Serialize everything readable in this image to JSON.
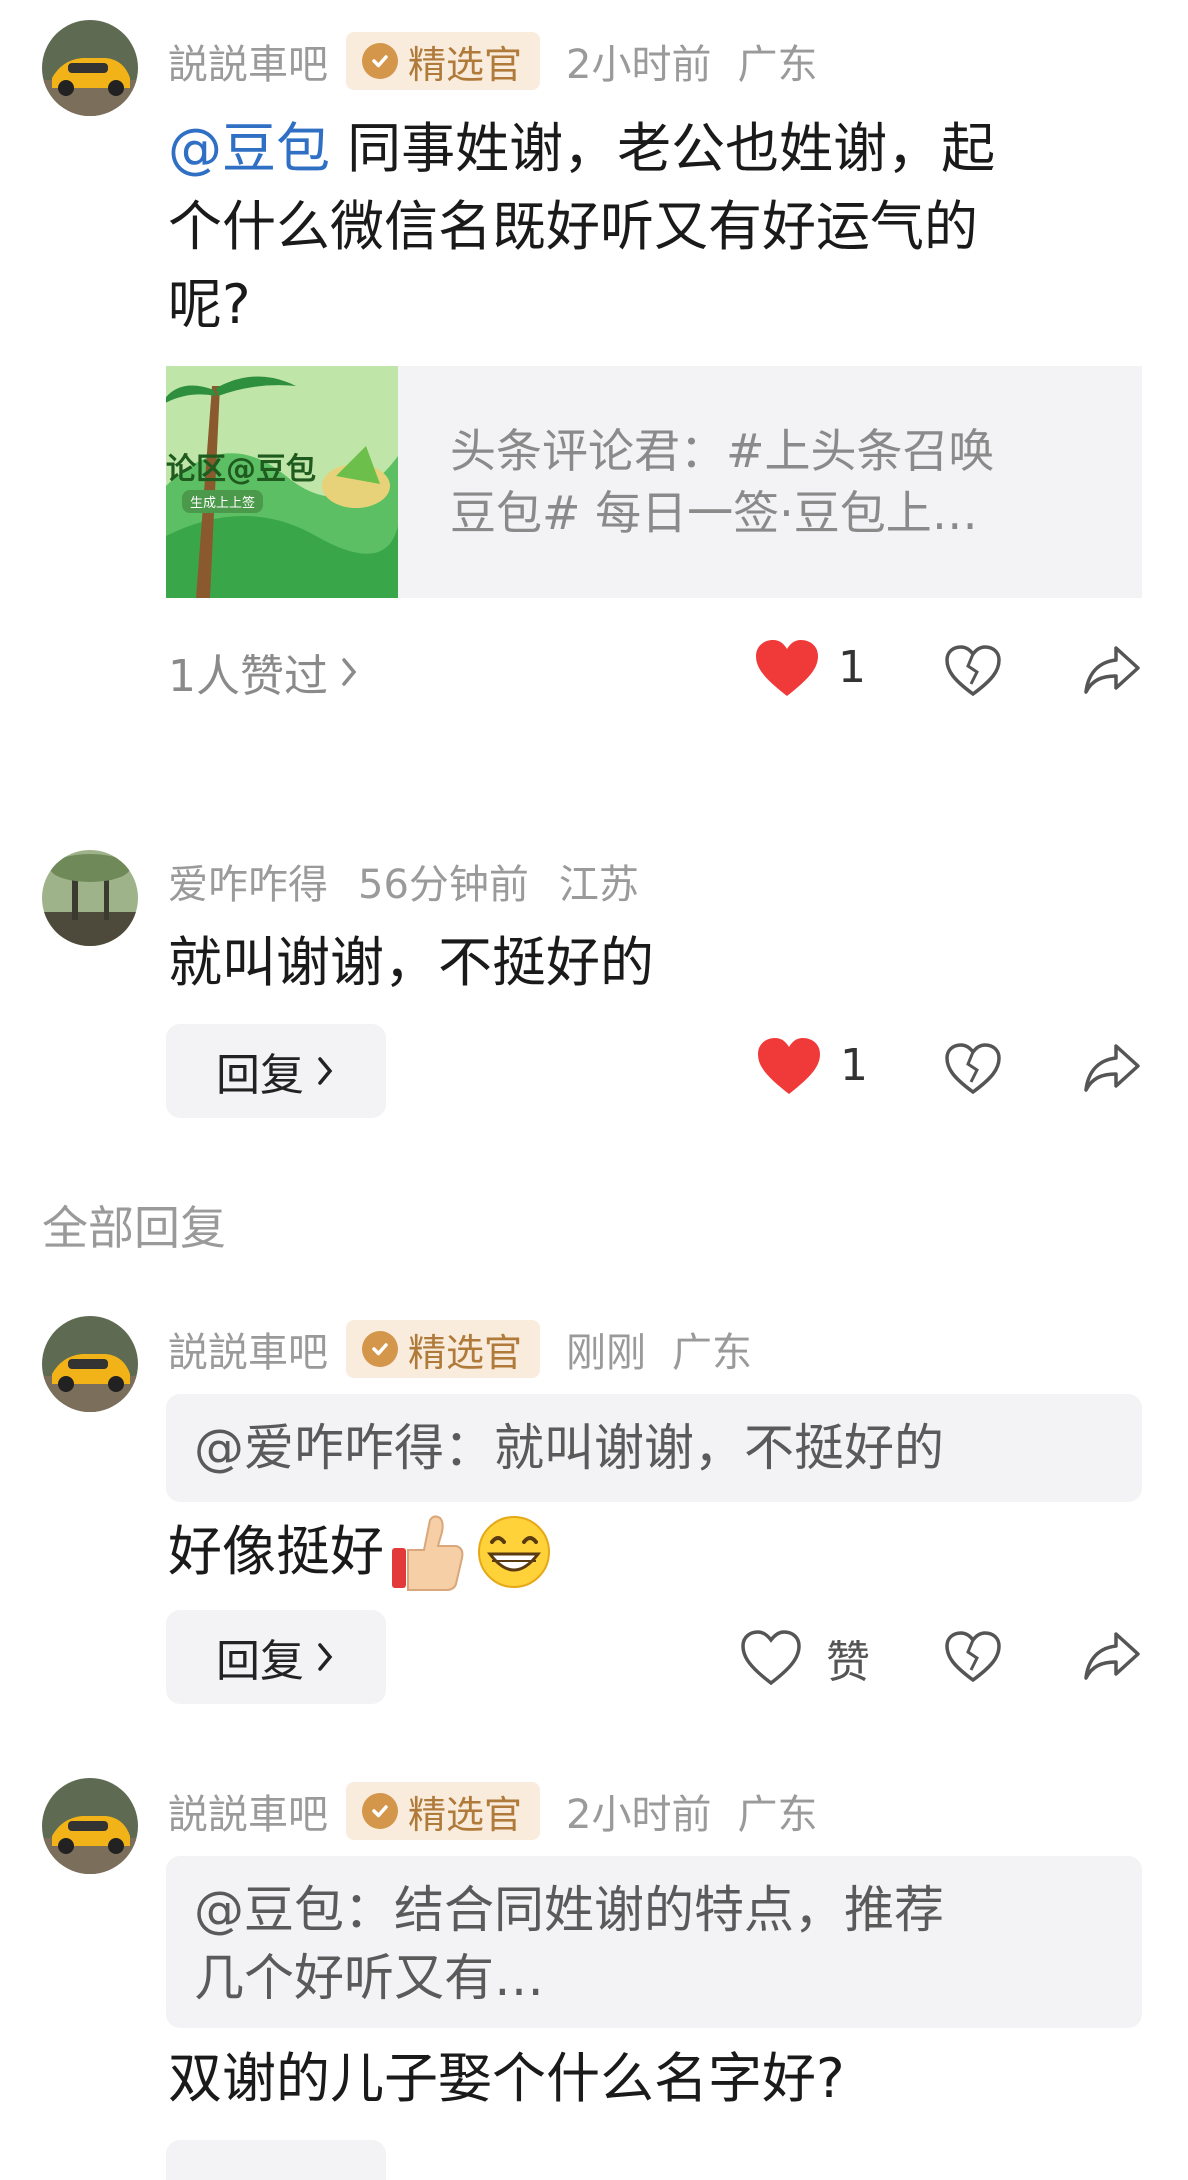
{
  "post": {
    "author": "説説車吧",
    "badge": "精选官",
    "time": "2小时前",
    "location": "广东",
    "mention": "@豆包",
    "line1": " 同事姓谢，老公也姓谢，起",
    "line2": "个什么微信名既好听又有好运气的",
    "line3": "呢?",
    "card": {
      "thumb_text": "论区@豆包",
      "thumb_sub": "生成上上签",
      "line1": "头条评论君：#上头条召唤",
      "line2": "豆包# 每日一签·豆包上…"
    },
    "likes_summary": "1人赞过",
    "like_count": "1"
  },
  "comment1": {
    "author": "爱咋咋得",
    "time": "56分钟前",
    "location": "江苏",
    "text": "就叫谢谢，不挺好的",
    "reply_label": "回复",
    "like_count": "1"
  },
  "section": {
    "title": "全部回复"
  },
  "reply1": {
    "author": "説説車吧",
    "badge": "精选官",
    "time": "刚刚",
    "location": "广东",
    "quote": "@爱咋咋得：就叫谢谢，不挺好的",
    "text": "好像挺好",
    "reply_label": "回复",
    "like_label": "赞"
  },
  "reply2": {
    "author": "説説車吧",
    "badge": "精选官",
    "time": "2小时前",
    "location": "广东",
    "quote_line1": "@豆包：结合同姓谢的特点，推荐",
    "quote_line2": "几个好听又有…",
    "text": "双谢的儿子娶个什么名字好?"
  },
  "colors": {
    "accent_link": "#2f6fc4",
    "like_red": "#f03a3a",
    "badge_bg": "#f9ecdc",
    "badge_fg": "#b07a3a"
  },
  "icons": [
    "heart-filled-icon",
    "heart-outline-icon",
    "broken-heart-icon",
    "share-icon",
    "chevron-right-icon",
    "check-badge-icon",
    "thumbs-up-emoji",
    "grin-emoji"
  ]
}
